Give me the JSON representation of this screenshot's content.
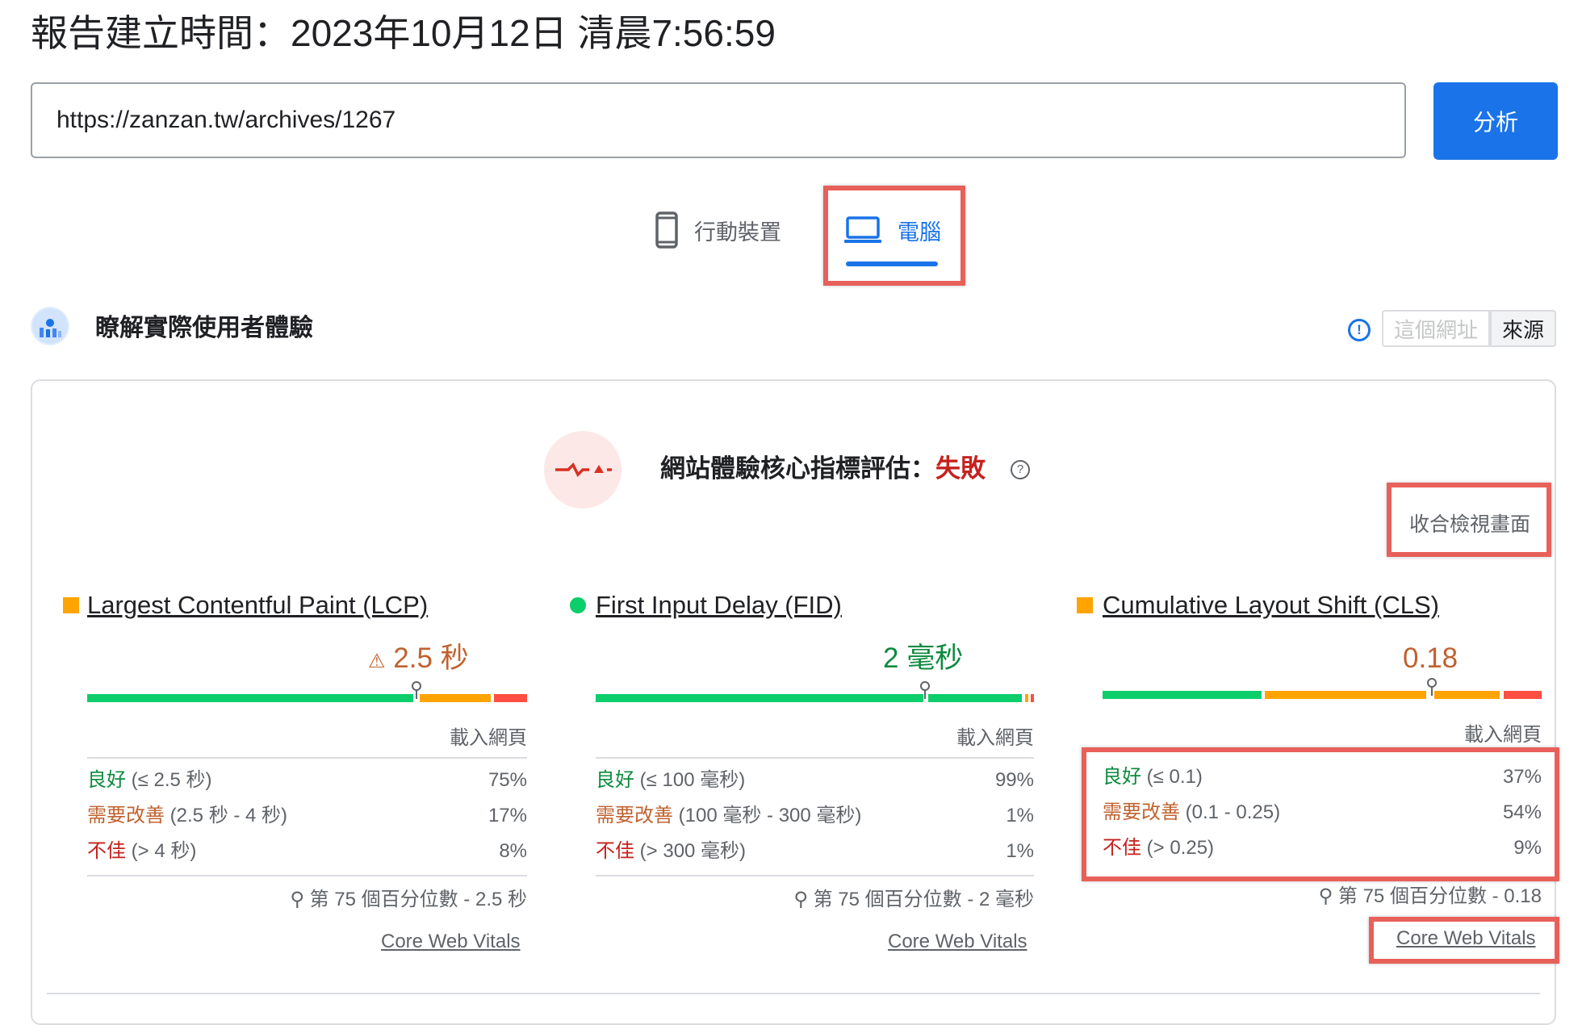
{
  "header": {
    "report_time": "報告建立時間：2023年10月12日 清晨7:56:59"
  },
  "search": {
    "url_value": "https://zanzan.tw/archives/1267",
    "analyze_label": "分析"
  },
  "tabs": [
    {
      "label": "行動裝置",
      "icon": "smartphone-icon",
      "selected": false
    },
    {
      "label": "電腦",
      "icon": "laptop-icon",
      "selected": true
    }
  ],
  "section": {
    "title": "瞭解實際使用者體驗",
    "toggle_url": "這個網址",
    "toggle_origin": "來源"
  },
  "assessment": {
    "label": "網站體驗核心指標評估：",
    "result": "失敗",
    "expand_label": "收合檢視畫面"
  },
  "colors": {
    "good": "#0cce6b",
    "needs_improvement": "#ffa400",
    "poor": "#ff4e42",
    "accent": "#1a73e8",
    "highlight": "#e8605a"
  },
  "metrics": [
    {
      "title": "Largest Contentful Paint (LCP)",
      "marker": "square-orange",
      "value": "2.5 秒",
      "warning_icon": "warning-triangle-icon",
      "sub_label": "載入網頁",
      "distribution": [
        {
          "label": "良好",
          "range": " (≤ 2.5 秒)",
          "percent": "75%",
          "fraction": 0.75
        },
        {
          "label": "需要改善",
          "range": " (2.5 秒 - 4 秒)",
          "percent": "17%",
          "fraction": 0.17
        },
        {
          "label": "不佳",
          "range": " (> 4 秒)",
          "percent": "8%",
          "fraction": 0.08
        }
      ],
      "percentile": "第 75 個百分位數 - 2.5 秒",
      "link": "Core Web Vitals"
    },
    {
      "title": "First Input Delay (FID)",
      "marker": "circle-green",
      "value": "2 毫秒",
      "sub_label": "載入網頁",
      "distribution": [
        {
          "label": "良好",
          "range": " (≤ 100 毫秒)",
          "percent": "99%",
          "fraction": 0.99
        },
        {
          "label": "需要改善",
          "range": " (100 毫秒 - 300 毫秒)",
          "percent": "1%",
          "fraction": 0.01
        },
        {
          "label": "不佳",
          "range": " (> 300 毫秒)",
          "percent": "1%",
          "fraction": 0.01
        }
      ],
      "percentile": "第 75 個百分位數 - 2 毫秒",
      "link": "Core Web Vitals"
    },
    {
      "title": "Cumulative Layout Shift (CLS)",
      "marker": "square-orange",
      "value": "0.18",
      "sub_label": "載入網頁",
      "distribution": [
        {
          "label": "良好",
          "range": " (≤ 0.1)",
          "percent": "37%",
          "fraction": 0.37
        },
        {
          "label": "需要改善",
          "range": " (0.1 - 0.25)",
          "percent": "54%",
          "fraction": 0.54
        },
        {
          "label": "不佳",
          "range": " (> 0.25)",
          "percent": "9%",
          "fraction": 0.09
        }
      ],
      "percentile": "第 75 個百分位數 - 0.18",
      "link": "Core Web Vitals"
    }
  ]
}
